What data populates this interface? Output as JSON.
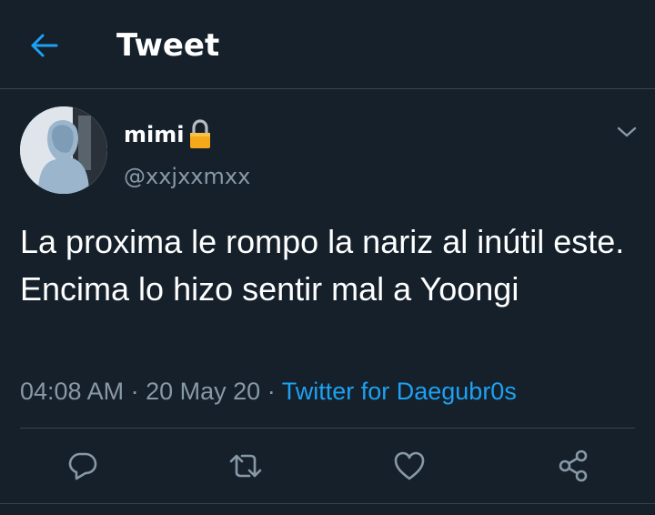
{
  "header": {
    "title": "Tweet",
    "back_icon": "arrow-left-icon"
  },
  "tweet": {
    "author": {
      "display_name": "mimi",
      "handle": "@xxjxxmxx",
      "protected_icon": "lock-icon"
    },
    "text": "La proxima le rompo la nariz al inútil este. Encima lo hizo sentir mal a Yoongi",
    "time": "04:08 AM",
    "separator": "·",
    "date": "20 May 20",
    "source": "Twitter for Daegubr0s"
  },
  "actions": [
    {
      "name": "reply-icon"
    },
    {
      "name": "retweet-icon"
    },
    {
      "name": "like-icon"
    },
    {
      "name": "share-icon"
    }
  ],
  "colors": {
    "background": "#15202b",
    "accent": "#1da1f2",
    "secondary_text": "#8899a6",
    "divider": "#38444d"
  }
}
